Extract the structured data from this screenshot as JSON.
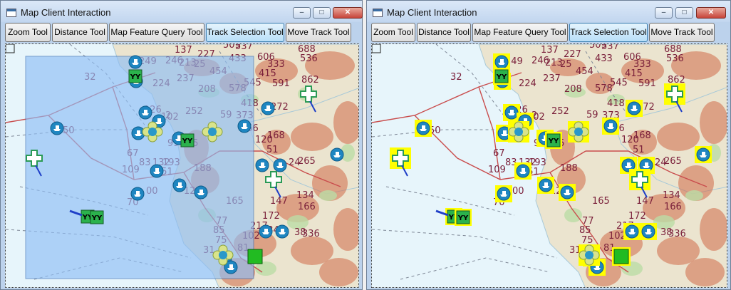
{
  "windows": [
    {
      "title": "Map Client Interaction",
      "controls": {
        "minimize": "–",
        "maximize": "□",
        "close": "✕"
      },
      "tools": [
        "Zoom Tool",
        "Distance Tool",
        "Map Feature Query Tool",
        "Track Selection Tool",
        "Move Track Tool"
      ],
      "active_tool": "Track Selection Tool",
      "selection_box_visible": true,
      "highlight": "none"
    },
    {
      "title": "Map Client Interaction",
      "controls": {
        "minimize": "–",
        "maximize": "□",
        "close": "✕"
      },
      "tools": [
        "Zoom Tool",
        "Distance Tool",
        "Map Feature Query Tool",
        "Track Selection Tool",
        "Move Track Tool"
      ],
      "active_tool": "Track Selection Tool",
      "selection_box_visible": false,
      "highlight": "yellow"
    }
  ],
  "map": {
    "labels": [
      "137",
      "227",
      "509",
      "537",
      "688",
      "249",
      "246",
      "213",
      "237",
      "25",
      "454",
      "433",
      "606",
      "333",
      "536",
      "415",
      "545",
      "578",
      "591",
      "862",
      "32",
      "224",
      "208",
      "126",
      "102",
      "252",
      "2",
      "59",
      "418",
      "373",
      "272",
      "50",
      "366",
      "168",
      "120",
      "51",
      "99",
      "85",
      "67",
      "109",
      "83",
      "132",
      "193",
      "151",
      "188",
      "265",
      "24",
      "70",
      "00",
      "129",
      "165",
      "134",
      "166",
      "147",
      "77",
      "85",
      "75",
      "217",
      "102",
      "234",
      "172",
      "336",
      "38",
      "31",
      "81"
    ],
    "track_symbols": [
      "boat",
      "cross",
      "YY",
      "flower",
      "square"
    ],
    "colors": {
      "water": "#e7f5fb",
      "land": "#ebe4cf",
      "relief": "#cf6a49",
      "forest": "#bcdca5",
      "route": "#c94d4d",
      "selection": "#8fbef5",
      "track": "#1f86c1",
      "highlight": "#ffff00"
    }
  }
}
